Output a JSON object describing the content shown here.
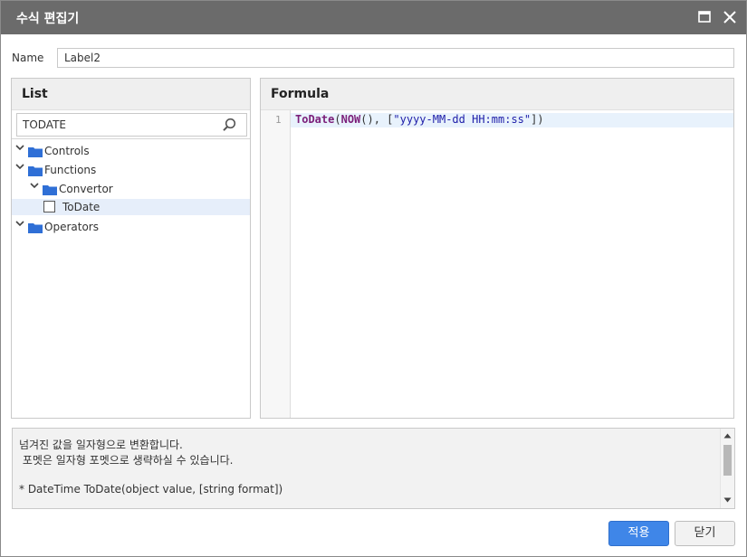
{
  "dialog": {
    "title": "수식 편집기",
    "maximize_icon": "maximize-icon",
    "close_icon": "close-icon"
  },
  "name_field": {
    "label": "Name",
    "value": "Label2"
  },
  "list_panel": {
    "title": "List",
    "search_value": "TODATE",
    "search_icon": "search-icon",
    "tree": [
      {
        "label": "Controls",
        "type": "folder",
        "expanded": true
      },
      {
        "label": "Functions",
        "type": "folder",
        "expanded": true
      },
      {
        "label": "Convertor",
        "type": "folder",
        "expanded": true
      },
      {
        "label": "ToDate",
        "type": "item",
        "checked": false,
        "selected": true
      },
      {
        "label": "Operators",
        "type": "folder",
        "expanded": true
      }
    ]
  },
  "formula_panel": {
    "title": "Formula",
    "line_number": "1",
    "code_tokens": [
      {
        "t": "ToDate",
        "c": "kw"
      },
      {
        "t": "(",
        "c": ""
      },
      {
        "t": "NOW",
        "c": "kw"
      },
      {
        "t": "(), [",
        "c": ""
      },
      {
        "t": "\"yyyy-MM-dd HH:mm:ss\"",
        "c": "str"
      },
      {
        "t": "])",
        "c": ""
      }
    ]
  },
  "description": {
    "lines": [
      "넘겨진 값을 일자형으로 변환합니다.",
      " 포멧은 일자형 포멧으로 생략하실 수 있습니다.",
      "",
      "* DateTime ToDate(object value, [string format])"
    ]
  },
  "buttons": {
    "apply": "적용",
    "close": "닫기"
  },
  "colors": {
    "titlebar": "#6b6b6b",
    "primary": "#3f86e8",
    "folder": "#2f6fd6",
    "selection": "#e6eefa"
  }
}
